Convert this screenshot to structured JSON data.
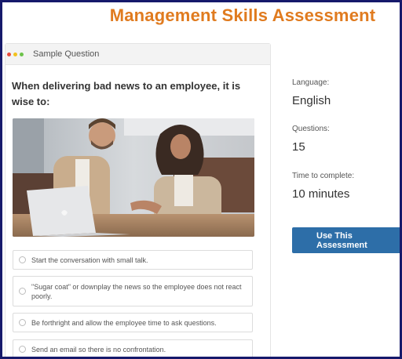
{
  "page": {
    "title": "Management Skills Assessment"
  },
  "sample_card": {
    "header_label": "Sample Question",
    "window_dots": {
      "red": "#e94b3c",
      "yellow": "#f2c11e",
      "green": "#6cc24a"
    },
    "question": "When delivering bad news to an employee, it is wise to:",
    "options": [
      "Start the conversation with small talk.",
      "\"Sugar coat\" or downplay the news so the employee does not react poorly.",
      "Be forthright and allow the employee time to ask questions.",
      "Send an email so there is no confrontation."
    ]
  },
  "details": {
    "language_label": "Language:",
    "language_value": "English",
    "questions_label": "Questions:",
    "questions_value": "15",
    "time_label": "Time to complete:",
    "time_value": "10 minutes"
  },
  "cta": {
    "label": "Use This Assessment",
    "color": "#2d6ea8"
  },
  "colors": {
    "title": "#e07b1f",
    "frame": "#16196b"
  }
}
